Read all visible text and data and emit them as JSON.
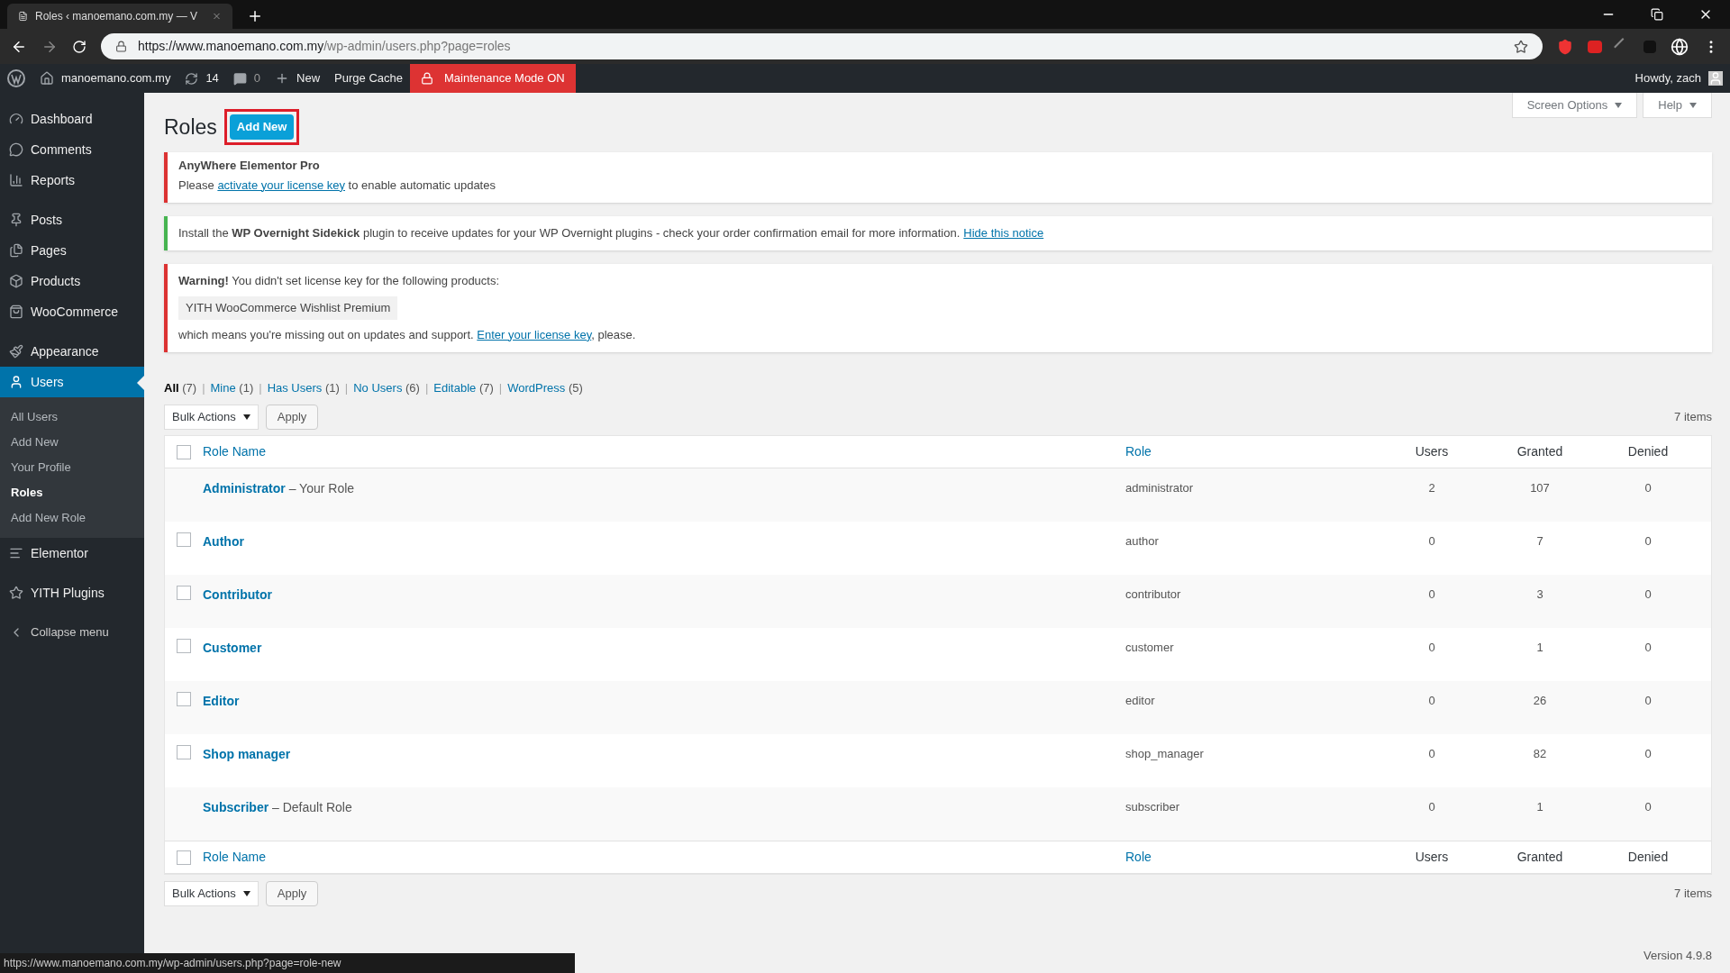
{
  "browser": {
    "tab_title": "Roles ‹ manoemano.com.my — V",
    "url_host": "https://www.manoemano.com.my",
    "url_path": "/wp-admin/users.php?page=roles"
  },
  "admin_bar": {
    "site": "manoemano.com.my",
    "updates": "14",
    "comments": "0",
    "new": "New",
    "purge": "Purge Cache",
    "maintenance": "Maintenance Mode ON",
    "howdy": "Howdy, zach"
  },
  "sidebar": {
    "sections": [
      [
        {
          "label": "Dashboard",
          "kind": "dashboard",
          "selected": false
        },
        {
          "label": "Comments",
          "kind": "comments",
          "selected": false
        },
        {
          "label": "Reports",
          "kind": "reports",
          "selected": false
        }
      ],
      [
        {
          "label": "Posts",
          "kind": "posts",
          "selected": false
        },
        {
          "label": "Pages",
          "kind": "pages",
          "selected": false
        },
        {
          "label": "Products",
          "kind": "products",
          "selected": false
        },
        {
          "label": "WooCommerce",
          "kind": "woo",
          "selected": false
        }
      ],
      [
        {
          "label": "Appearance",
          "kind": "appearance",
          "selected": false
        },
        {
          "label": "Users",
          "kind": "users",
          "selected": true,
          "children": [
            {
              "label": "All Users",
              "selected": false
            },
            {
              "label": "Add New",
              "selected": false
            },
            {
              "label": "Your Profile",
              "selected": false
            },
            {
              "label": "Roles",
              "selected": true
            },
            {
              "label": "Add New Role",
              "selected": false
            }
          ]
        },
        {
          "label": "Elementor",
          "kind": "elementor",
          "selected": false
        }
      ],
      [
        {
          "label": "YITH Plugins",
          "kind": "yith",
          "selected": false
        }
      ],
      [
        {
          "label": "Collapse menu",
          "kind": "collapse",
          "selected": false
        }
      ]
    ]
  },
  "screen_options": "Screen Options",
  "help": "Help",
  "page_title": "Roles",
  "add_new": "Add New",
  "notices": [
    {
      "color": "#dc3232",
      "title": "AnyWhere Elementor Pro",
      "text_before": "Please ",
      "link": "activate your license key",
      "text_after": " to enable automatic updates"
    },
    {
      "color": "#46b450",
      "text": "Install the **WP Overnight Sidekick** plugin to receive updates for your WP Overnight plugins - check your order confirmation email for more information.",
      "link": "Hide this notice"
    },
    {
      "color": "#dc3232",
      "text": "**Warning!** You didn't set license key for the following products:",
      "product": "YITH WooCommerce Wishlist Premium",
      "text_before": "which means you're missing out on updates and support. ",
      "link": "Enter your license key",
      "text_after": ", please."
    }
  ],
  "filters": [
    {
      "label": "All",
      "count": "(7)",
      "selected": true
    },
    {
      "separator": "|",
      "label": "Mine",
      "count": "(1)",
      "selected": false
    },
    {
      "separator": "|",
      "label": "Has Users",
      "count": "(1)",
      "selected": false
    },
    {
      "separator": "|",
      "label": "No Users",
      "count": "(6)",
      "selected": false
    },
    {
      "separator": "|",
      "label": "Editable",
      "count": "(7)",
      "selected": false
    },
    {
      "separator": "|",
      "label": "WordPress",
      "count": "(5)",
      "selected": false
    }
  ],
  "bulk_actions": "Bulk Actions",
  "apply": "Apply",
  "items_count": "7 items",
  "table": {
    "columns": [
      "Role Name",
      "Role",
      "Users",
      "Granted",
      "Denied"
    ],
    "select_all_checked": false,
    "rows": [
      {
        "name": "Administrator",
        "note": "– Your Role",
        "role": "administrator",
        "users": "2",
        "granted": "107",
        "denied": "0"
      },
      {
        "name": "Author",
        "checked": false,
        "role": "author",
        "users": "0",
        "granted": "7",
        "denied": "0"
      },
      {
        "name": "Contributor",
        "checked": false,
        "role": "contributor",
        "users": "0",
        "granted": "3",
        "denied": "0"
      },
      {
        "name": "Customer",
        "checked": false,
        "role": "customer",
        "users": "0",
        "granted": "1",
        "denied": "0"
      },
      {
        "name": "Editor",
        "checked": false,
        "role": "editor",
        "users": "0",
        "granted": "26",
        "denied": "0"
      },
      {
        "name": "Shop manager",
        "checked": false,
        "role": "shop_manager",
        "users": "0",
        "granted": "82",
        "denied": "0"
      },
      {
        "name": "Subscriber",
        "note": "– Default Role",
        "role": "subscriber",
        "users": "0",
        "granted": "1",
        "denied": "0"
      }
    ],
    "footer_columns": [
      "Role Name",
      "Role",
      "Users",
      "Granted",
      "Denied"
    ],
    "footer_select_all_checked": false
  },
  "bottom_bulk_actions": "Bulk Actions",
  "bottom_apply": "Apply",
  "bottom_items_count": "7 items",
  "version": "Version 4.9.8",
  "status_url": "https://www.manoemano.com.my/wp-admin/users.php?page=role-new"
}
